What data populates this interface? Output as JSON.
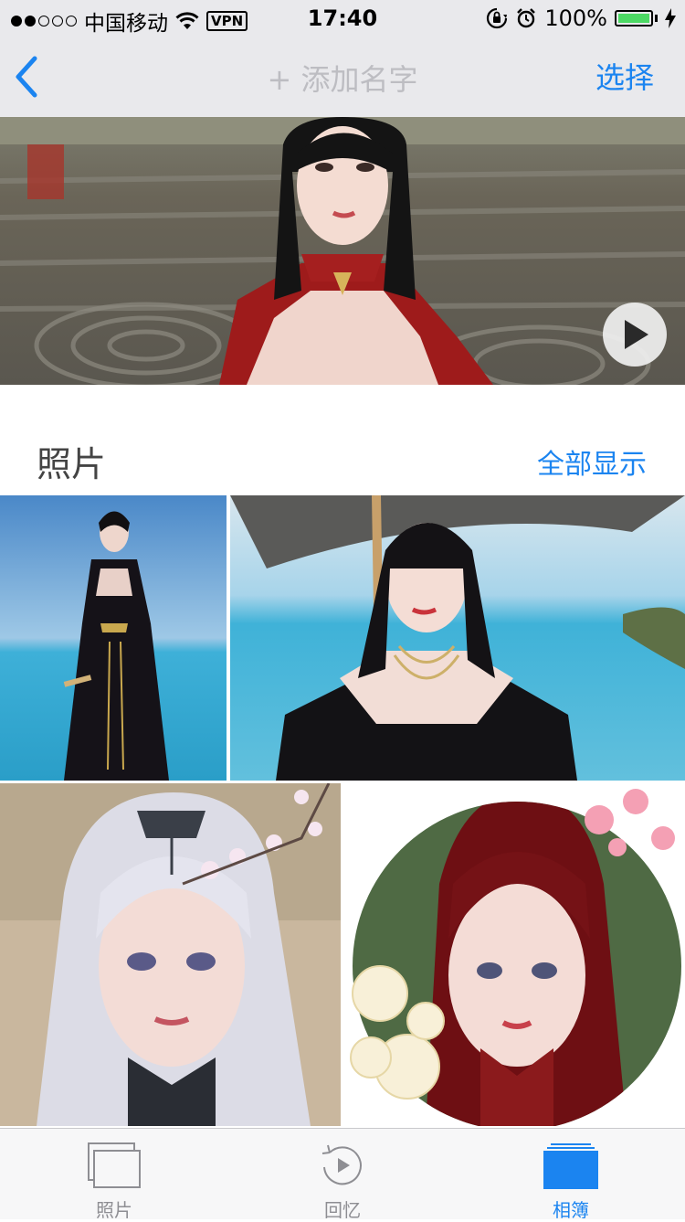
{
  "status_bar": {
    "carrier": "中国移动",
    "vpn": "VPN",
    "time": "17:40",
    "battery": "100%",
    "battery_level": 1.0,
    "signal_filled": 2,
    "signal_total": 5,
    "icons": [
      "wifi-icon",
      "rotation-lock-icon",
      "alarm-icon",
      "battery-icon",
      "charging-icon"
    ]
  },
  "nav": {
    "back_icon": "chevron-left-icon",
    "title": "+ 添加名字",
    "select": "选择"
  },
  "hero": {
    "type": "video",
    "play_icon": "play-icon"
  },
  "section": {
    "title": "照片",
    "show_all": "全部显示"
  },
  "photos": [
    {
      "desc": "character in black dress by sea"
    },
    {
      "desc": "character with umbrella by sea"
    },
    {
      "desc": "white hair character with flowers"
    },
    {
      "desc": "red hair character in circle frame"
    }
  ],
  "tabs": [
    {
      "label": "照片",
      "icon": "photos-icon",
      "active": false
    },
    {
      "label": "回忆",
      "icon": "memories-icon",
      "active": false
    },
    {
      "label": "相簿",
      "icon": "albums-icon",
      "active": true
    }
  ],
  "colors": {
    "accent": "#1b84f0",
    "bar_bg": "#e9e9ec",
    "tab_inactive": "#8e8e93",
    "battery_green": "#4cd964"
  }
}
